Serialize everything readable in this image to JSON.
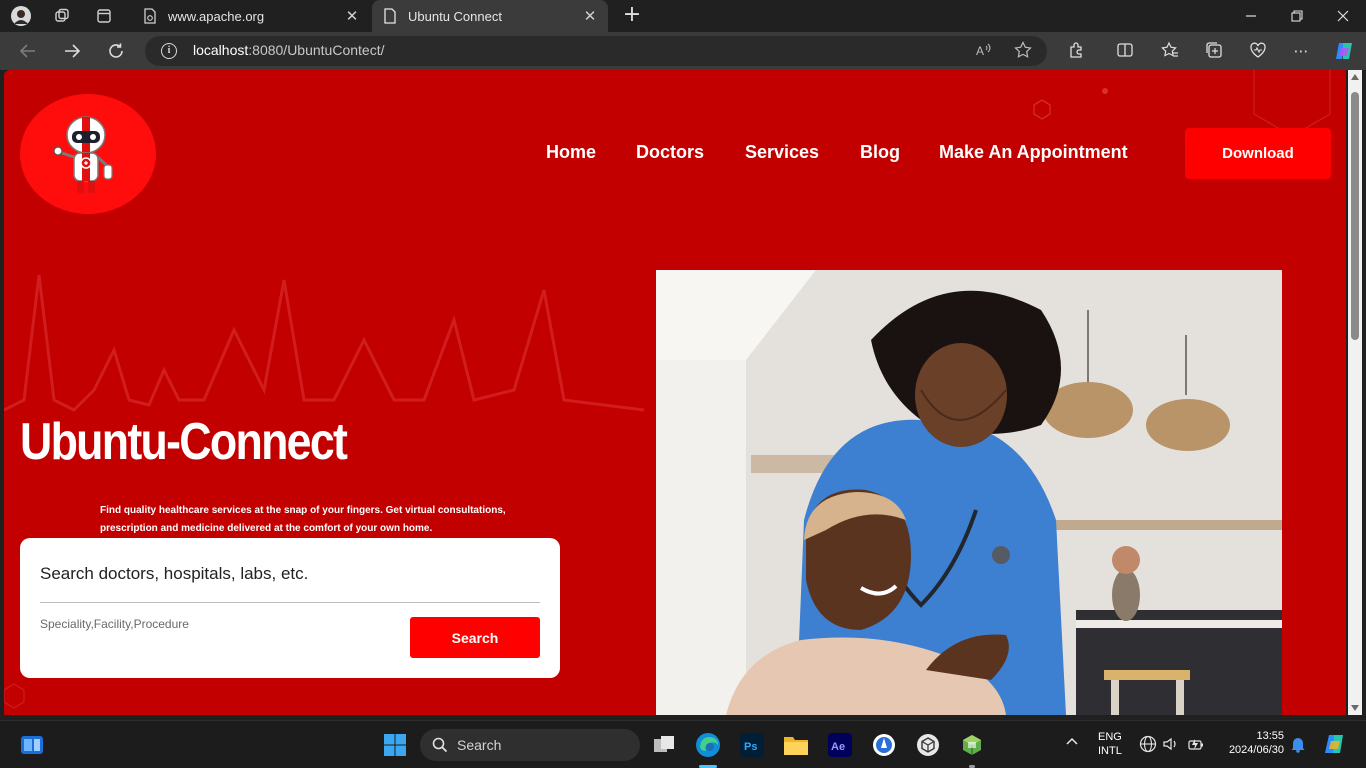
{
  "browser": {
    "tabs": [
      {
        "title": "www.apache.org",
        "active": false
      },
      {
        "title": "Ubuntu Connect",
        "active": true
      }
    ],
    "url": {
      "host": "localhost",
      "rest": ":8080/UbuntuContect/"
    }
  },
  "site": {
    "nav": {
      "home": "Home",
      "doctors": "Doctors",
      "services": "Services",
      "blog": "Blog",
      "appointment": "Make An Appointment"
    },
    "download_label": "Download",
    "hero": {
      "title": "Ubuntu-Connect",
      "subtitle": "Find quality healthcare services at the snap of your fingers. Get virtual consultations, prescription and medicine delivered at the comfort of your own home."
    },
    "search": {
      "main_placeholder": "Search doctors, hospitals, labs, etc.",
      "sub_placeholder": "Speciality,Facility,Procedure",
      "button_label": "Search"
    },
    "colors": {
      "page_bg": "#c20000",
      "accent": "#ff0000"
    }
  },
  "taskbar": {
    "search_label": "Search",
    "apps": [
      "start",
      "search",
      "task-view",
      "edge",
      "photoshop",
      "file-explorer",
      "after-effects",
      "app-one",
      "app-two",
      "app-three"
    ],
    "lang_line1": "ENG",
    "lang_line2": "INTL",
    "time": "13:55",
    "date": "2024/06/30"
  }
}
